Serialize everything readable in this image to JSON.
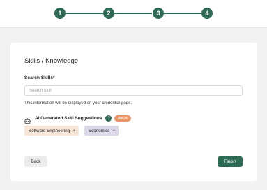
{
  "stepper": {
    "steps": [
      "1",
      "2",
      "3",
      "4"
    ],
    "color": "#2e6b55"
  },
  "card": {
    "title": "Skills / Knowledge",
    "search_label": "Search Skills*",
    "search_placeholder": "Search Skill",
    "search_value": "",
    "helper_text": "This information will be displayed on your credential page."
  },
  "ai_suggestions": {
    "label": "AI Generated Skill Suggestions",
    "help_symbol": "?",
    "badge": "BETA",
    "icon": "robot-icon",
    "chips": [
      {
        "label": "Software Engineering",
        "action": "+"
      },
      {
        "label": "Economics",
        "action": "+"
      }
    ]
  },
  "footer": {
    "back_label": "Back",
    "finish_label": "Finish"
  },
  "colors": {
    "accent": "#2e6b55",
    "beta": "#e8956a",
    "chip_1_bg": "#f7e6d8",
    "chip_2_bg": "#dcd8e8",
    "page_bg": "#f2f2f2"
  }
}
